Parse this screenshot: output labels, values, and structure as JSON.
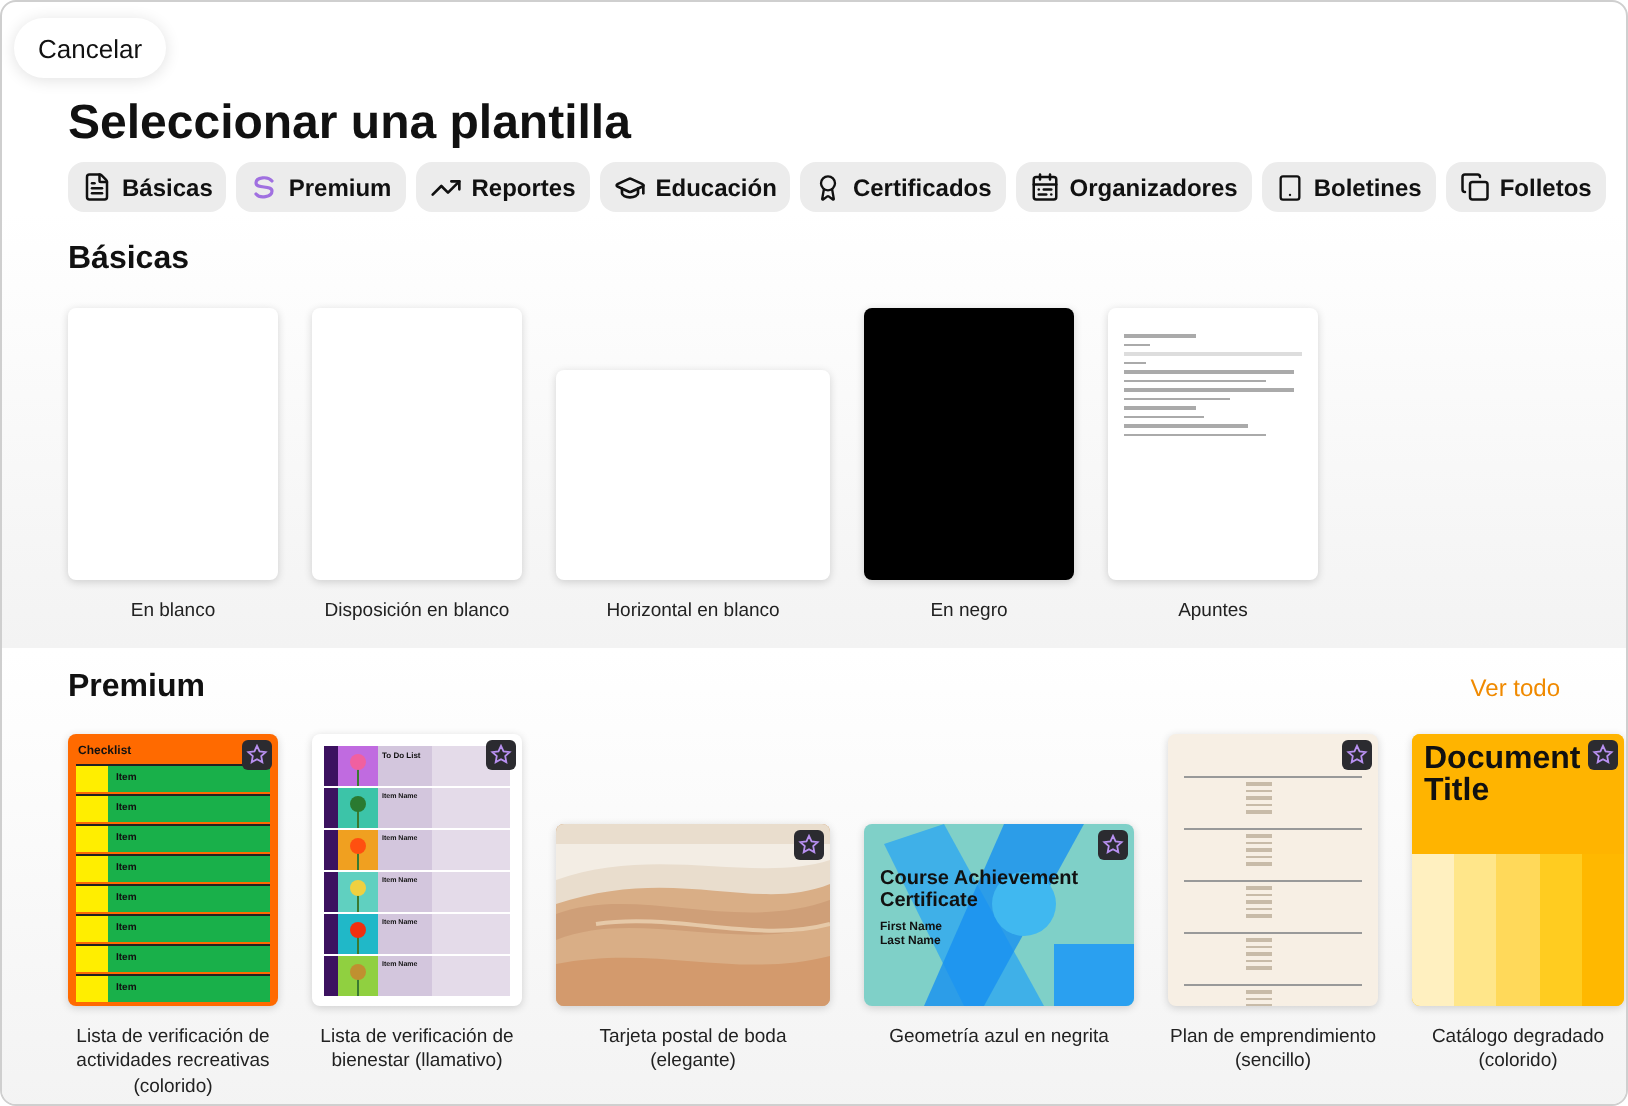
{
  "cancel_button": "Cancelar",
  "title": "Seleccionar una plantilla",
  "categories": [
    {
      "label": "Básicas"
    },
    {
      "label": "Premium"
    },
    {
      "label": "Reportes"
    },
    {
      "label": "Educación"
    },
    {
      "label": "Certificados"
    },
    {
      "label": "Organizadores"
    },
    {
      "label": "Boletines"
    },
    {
      "label": "Folletos"
    }
  ],
  "sections": [
    {
      "title": "Básicas",
      "templates": [
        {
          "label": "En blanco",
          "kind": "blank",
          "premium": false
        },
        {
          "label": "Disposición en blanco",
          "kind": "blank",
          "premium": false
        },
        {
          "label": "Horizontal en blanco",
          "kind": "wide",
          "premium": false
        },
        {
          "label": "En negro",
          "kind": "black",
          "premium": false
        },
        {
          "label": "Apuntes",
          "kind": "notes",
          "premium": false
        }
      ]
    },
    {
      "title": "Premium",
      "see_all": "Ver todo",
      "templates": [
        {
          "label": "Lista de verificación de actividades recreativas (colorido)",
          "kind": "checklist",
          "premium": true,
          "heading": "Checklist",
          "items": [
            "Item",
            "Item",
            "Item",
            "Item",
            "Item",
            "Item",
            "Item",
            "Item"
          ]
        },
        {
          "label": "Lista de verificación de bienestar (llamativo)",
          "kind": "wellness",
          "premium": true,
          "heading": "To Do List",
          "items": [
            "Item Name",
            "Item Name",
            "Item Name",
            "Item Name",
            "Item Name"
          ]
        },
        {
          "label": "Tarjeta postal de boda (elegante)",
          "kind": "picture",
          "premium": true
        },
        {
          "label": "Geometría azul en negrita",
          "kind": "certificate",
          "premium": true,
          "heading": "Course Achievement Certificate",
          "items": [
            "First Name",
            "Last Name"
          ]
        },
        {
          "label": "Plan de emprendimiento (sencillo)",
          "kind": "plan",
          "premium": true
        },
        {
          "label": "Catálogo degradado (colorido)",
          "kind": "catalog",
          "premium": true,
          "heading": "Document Title"
        }
      ]
    }
  ]
}
